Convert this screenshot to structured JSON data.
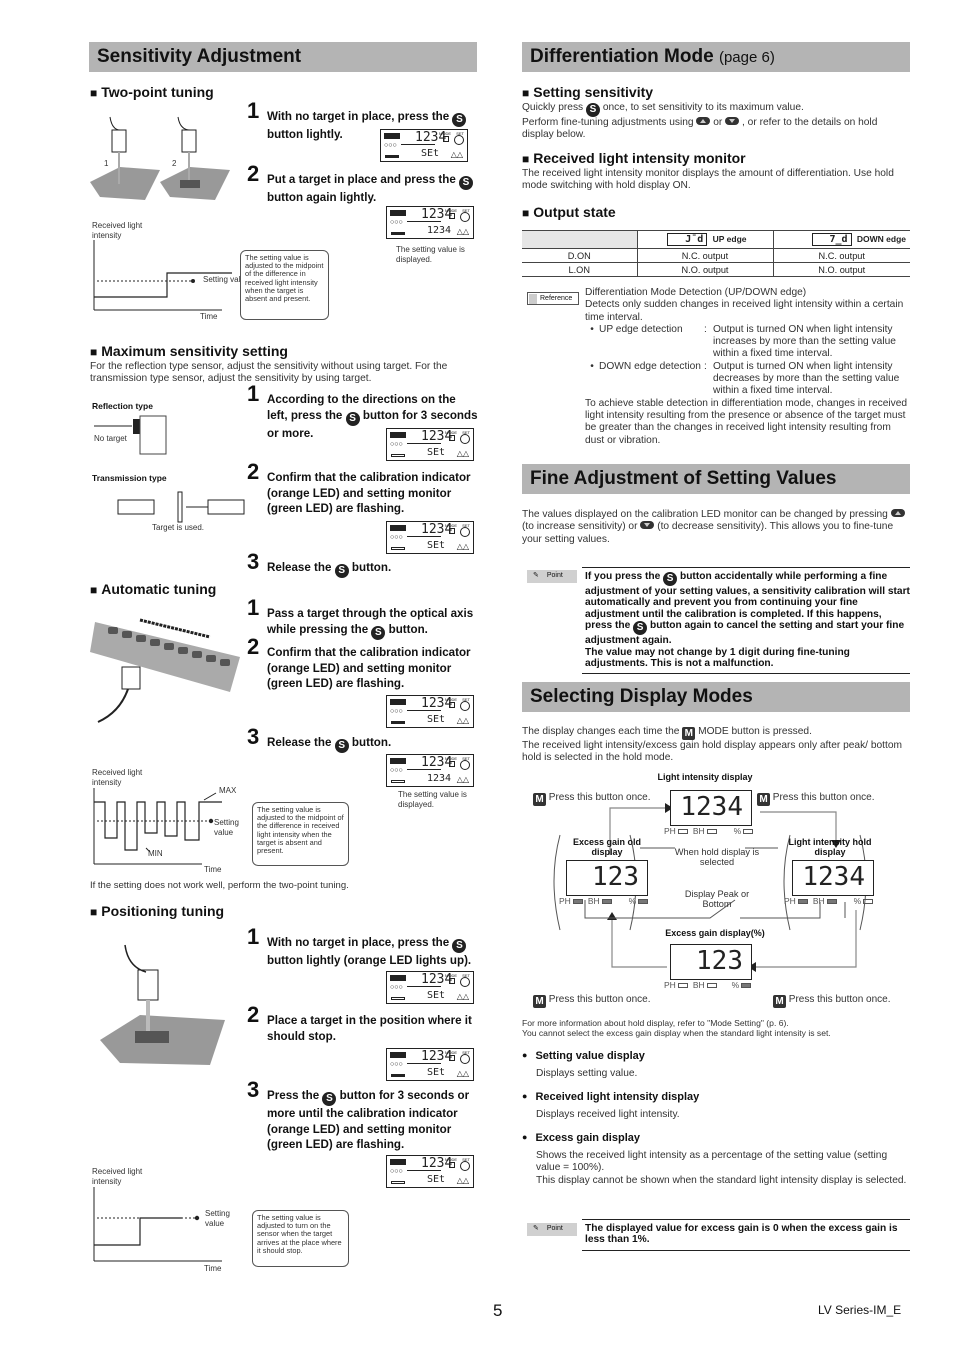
{
  "left": {
    "title": "Sensitivity Adjustment",
    "two_point": {
      "heading": "Two-point tuning",
      "fig_labels": [
        "1",
        "2"
      ],
      "steps": [
        {
          "num": "1",
          "pre": "With no target in place, press the",
          "post": "button lightly."
        },
        {
          "num": "2",
          "pre": "Put a target in place and press the",
          "post": "button again lightly."
        }
      ],
      "lcd1": {
        "big": "1234",
        "small": "SEt"
      },
      "lcd2": {
        "big": "1234",
        "small": "1234"
      },
      "lcd2_caption": "The setting value is displayed.",
      "graph": {
        "ylabel": "Received light intensity",
        "xlabel": "Time",
        "setting_label": "Setting value"
      },
      "callout": "The setting value is adjusted to the midpoint of the difference in received light intensity when the target is absent and present."
    },
    "max_sens": {
      "heading": "Maximum sensitivity setting",
      "desc": "For the reflection type sensor, adjust the sensitivity without using target. For the transmission type sensor, adjust the sensitivity by using target.",
      "reflection_label": "Reflection type",
      "no_target": "No target",
      "transmission_label": "Transmission type",
      "target_used": "Target is used.",
      "steps": [
        {
          "num": "1",
          "pre": "According to the directions on the left, press the",
          "post": "button for 3 seconds or more."
        },
        {
          "num": "2",
          "text": "Confirm that the calibration indicator (orange LED) and setting monitor (green LED) are flashing."
        },
        {
          "num": "3",
          "pre": "Release the",
          "post": "button."
        }
      ],
      "lcd1": {
        "big": "1234",
        "small": "SEt"
      },
      "lcd2": {
        "big": "1234",
        "small": "SEt"
      }
    },
    "auto": {
      "heading": "Automatic tuning",
      "steps": [
        {
          "num": "1",
          "pre": "Pass a target through the optical axis while pressing the",
          "post": "button."
        },
        {
          "num": "2",
          "text": "Confirm that the calibration indicator (orange LED) and setting monitor (green LED) are flashing."
        },
        {
          "num": "3",
          "pre": "Release the",
          "post": "button."
        }
      ],
      "lcd1": {
        "big": "1234",
        "small": "SEt"
      },
      "lcd2": {
        "big": "1234",
        "small": "1234"
      },
      "lcd2_caption": "The setting value is displayed.",
      "graph": {
        "ylabel": "Received light intensity",
        "xlabel": "Time",
        "setting_label": "Setting value",
        "max": "MAX",
        "min": "MIN"
      },
      "callout": "The setting value is adjusted to the midpoint of the difference in received light intensity when the target is absent and present.",
      "note": "If the setting does not work well, perform the two-point tuning."
    },
    "positioning": {
      "heading": "Positioning tuning",
      "steps": [
        {
          "num": "1",
          "pre": "With no target in place, press the",
          "post": "button lightly (orange LED lights up)."
        },
        {
          "num": "2",
          "text": "Place a target in the position where it should stop."
        },
        {
          "num": "3",
          "pre": "Press the",
          "post": "button for 3 seconds or more until the calibration indicator (orange LED) and setting monitor (green LED) are flashing."
        }
      ],
      "lcd1": {
        "big": "1234",
        "small": "SEt"
      },
      "lcd2": {
        "big": "1234",
        "small": "SEt"
      },
      "lcd3": {
        "big": "1234",
        "small": "SEt"
      },
      "graph": {
        "ylabel": "Received light intensity",
        "xlabel": "Time",
        "setting_label": "Setting value"
      },
      "callout": "The setting value is adjusted to turn on the sensor when the target arrives at the place where it should stop."
    }
  },
  "right": {
    "diff": {
      "title": "Differentiation Mode",
      "title_small": "(page 6)",
      "setting": {
        "heading": "Setting sensitivity",
        "line1_pre": "Quickly press",
        "line1_post": "once, to set sensitivity to its maximum value.",
        "line2_pre": "Perform fine-tuning adjustments using",
        "line2_or": "or",
        "line2_post": ", or refer to the details on hold display below."
      },
      "monitor": {
        "heading": "Received light intensity monitor",
        "desc": "The received light intensity monitor displays the amount of differentiation. Use hold mode switching with hold display ON."
      },
      "output": {
        "heading": "Output state",
        "columns": [
          {
            "code": "┐‾┐",
            "seg": "J¯d",
            "label": "UP edge"
          },
          {
            "code": "7_d",
            "seg": "7_d",
            "label": "DOWN edge"
          }
        ],
        "rows": [
          {
            "mode": "D.ON",
            "up": "N.C. output",
            "down": "N.C. output"
          },
          {
            "mode": "L.ON",
            "up": "N.O. output",
            "down": "N.O. output"
          }
        ]
      },
      "reference": {
        "tag": "Reference",
        "title": "Differentiation Mode Detection (UP/DOWN edge)",
        "desc": "Detects only sudden changes in received light intensity within a certain time interval.",
        "items": [
          {
            "label": "UP edge detection",
            "text": "Output is turned ON when light intensity increases by more than the setting value within a fixed time interval."
          },
          {
            "label": "DOWN edge detection",
            "text": "Output is turned ON when light intensity decreases by more than the setting value within a fixed time interval."
          }
        ],
        "footer": "To achieve stable detection in differentiation mode, changes in received light intensity resulting from the presence or absence of the target must be greater than the changes in received light intensity resulting from dust or vibration."
      }
    },
    "fine": {
      "title": "Fine Adjustment of Setting Values",
      "desc_pre": "The values displayed on the calibration LED monitor can be changed by pressing",
      "desc_mid": "(to increase sensitivity) or",
      "desc_post": "(to decrease sensitivity). This allows you to fine-tune your setting values.",
      "point_tag": "Point",
      "point_p1_pre": "If you press the",
      "point_p1_post": "button accidentally while performing a fine adjustment of your setting values, a sensitivity calibration will start automatically and prevent you from continuing your fine adjustment until the calibration is completed. If this happens, press the",
      "point_p1_end": "button again to cancel the setting and start your fine adjustment again.",
      "point_p2": "The value may not change by 1 digit during fine-tuning adjustments. This is not a malfunction."
    },
    "display": {
      "title": "Selecting Display Modes",
      "desc_pre": "The display changes each time the",
      "desc_post": "MODE button is pressed.",
      "desc2": "The received light intensity/excess gain hold display appears only after peak/ bottom hold is selected in the hold mode.",
      "diagram": {
        "top_label": "Light intensity display",
        "top_value": "1234",
        "left_label": "Excess gain old display",
        "left_value": "123",
        "right_label": "Light intensity hold display",
        "right_value": "1234",
        "bottom_label": "Excess gain display(%)",
        "bottom_value": "123",
        "press_once": "Press this button once.",
        "press_once_alt": "Press this button once.",
        "hold_note": "When hold display is selected",
        "peak_note": "Display Peak or Bottom",
        "ind_ph": "PH",
        "ind_bh": "BH",
        "ind_pct": "%"
      },
      "note1": "For more information about hold display, refer to \"Mode Setting\" (p. 6).",
      "note2": "You cannot select the excess gain display when the standard light intensity is set.",
      "items": [
        {
          "title": "Setting value display",
          "desc": "Displays setting value."
        },
        {
          "title": "Received light intensity display",
          "desc": "Displays received light intensity."
        },
        {
          "title": "Excess gain display",
          "desc": "Shows the received light intensity as a percentage of the setting value (setting value = 100%).\nThis display cannot be shown when the standard light intensity display is selected."
        }
      ],
      "point_tag": "Point",
      "point_text": "The displayed value for excess gain is 0 when the excess gain is less than 1%."
    }
  },
  "footer": {
    "page": "5",
    "doc": "LV Series-IM_E"
  },
  "icons": {
    "s_button": "S",
    "m_button": "M"
  },
  "lcd_labels": {
    "mode": "MODE",
    "set": "SET",
    "ooo": "○○○"
  }
}
